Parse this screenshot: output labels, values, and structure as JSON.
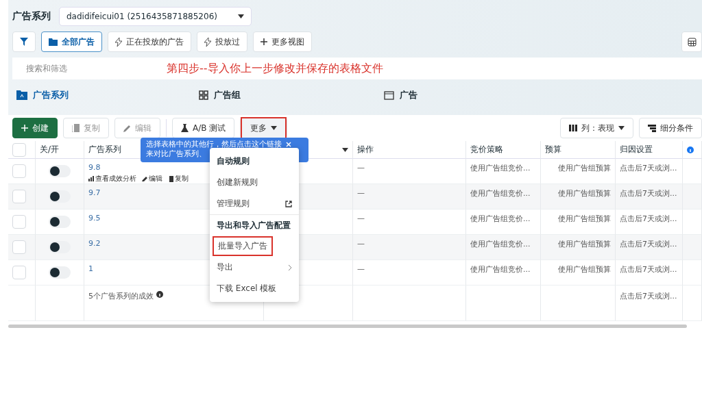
{
  "header": {
    "title": "广告系列",
    "account": "dadidifeicui01 (2516435871885206)"
  },
  "views": [
    {
      "kind": "filter",
      "selected": false
    },
    {
      "kind": "folder",
      "label": "全部广告",
      "selected": true
    },
    {
      "kind": "bolt",
      "label": "正在投放的广告",
      "selected": false
    },
    {
      "kind": "bolt",
      "label": "投放过",
      "selected": false
    },
    {
      "kind": "plus",
      "label": "更多视图",
      "selected": false
    }
  ],
  "search": {
    "placeholder": "搜索和筛选"
  },
  "annotation": "第四步--导入你上一步修改并保存的表格文件",
  "levels": [
    {
      "kind": "campaign",
      "label": "广告系列",
      "selected": true
    },
    {
      "kind": "adset",
      "label": "广告组",
      "selected": false
    },
    {
      "kind": "ad",
      "label": "广告",
      "selected": false
    }
  ],
  "toolbar": {
    "create": "创建",
    "copy": "复制",
    "edit": "编辑",
    "abtest": "A/B 测试",
    "more": "更多",
    "columns": "列：表现",
    "breakdown": "细分条件"
  },
  "tooltip": {
    "lines": [
      "选择表格中的其他行，然后点击这个链接",
      "来对比广告系列、"
    ]
  },
  "menu": [
    {
      "kind": "heading",
      "label": "自动规则",
      "highlighted": false
    },
    {
      "kind": "item",
      "label": "创建新规则",
      "highlighted": false
    },
    {
      "kind": "external",
      "label": "管理规则",
      "highlighted": false
    },
    {
      "kind": "heading",
      "label": "导出和导入广告配置",
      "highlighted": false
    },
    {
      "kind": "item",
      "label": "批量导入广告",
      "highlighted": true
    },
    {
      "kind": "submenu",
      "label": "导出",
      "highlighted": false
    },
    {
      "kind": "item",
      "label": "下载 Excel 模板",
      "highlighted": false
    }
  ],
  "table": {
    "all_checked": false,
    "columns": [
      "关/开",
      "广告系列",
      "",
      "操作",
      "竞价策略",
      "预算",
      "归因设置"
    ],
    "rows": [
      {
        "checked": false,
        "on": false,
        "name": "9.8",
        "actions": [
          "查看成效分析",
          "编辑",
          "复制"
        ],
        "operation": "—",
        "bid": "使用广告组竞价...",
        "budget": "使用广告组预算",
        "attribution": "点击后7天或浏..."
      },
      {
        "checked": false,
        "on": false,
        "name": "9.7",
        "operation": "—",
        "bid": "使用广告组竞价...",
        "budget": "使用广告组预算",
        "attribution": "点击后7天或浏..."
      },
      {
        "checked": false,
        "on": false,
        "name": "9.5",
        "operation": "—",
        "bid": "使用广告组竞价...",
        "budget": "使用广告组预算",
        "attribution": "点击后7天或浏..."
      },
      {
        "checked": false,
        "on": false,
        "name": "9.2",
        "operation": "—",
        "bid": "使用广告组竞价...",
        "budget": "使用广告组预算",
        "attribution": "点击后7天或浏..."
      },
      {
        "checked": false,
        "on": false,
        "name": "1",
        "operation": "—",
        "bid": "使用广告组竞价...",
        "budget": "使用广告组预算",
        "attribution": "点击后7天或浏..."
      }
    ],
    "summary": {
      "label": "5个广告系列的成效",
      "attribution": "点击后7天或浏..."
    }
  }
}
